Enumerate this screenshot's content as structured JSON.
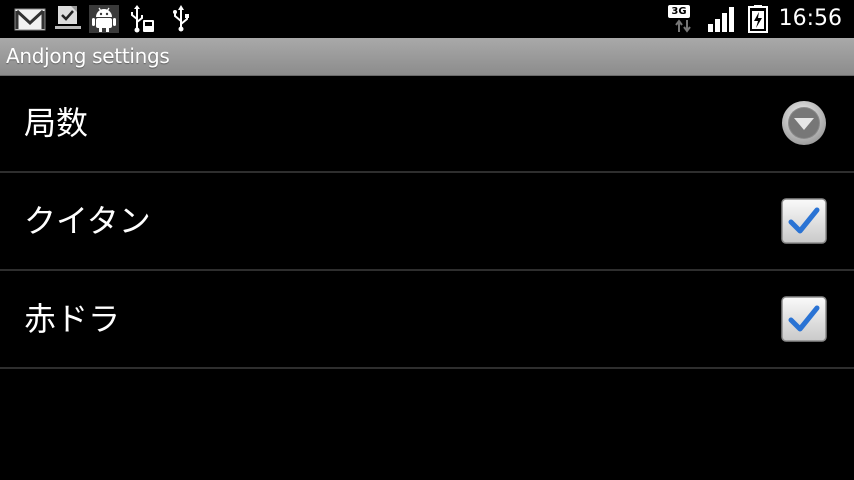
{
  "status_bar": {
    "notifications": [
      "gmail-icon",
      "download-done-icon",
      "android-debug-icon",
      "usb-storage-icon",
      "usb-icon"
    ],
    "network_type": "3G",
    "time": "16:56"
  },
  "title_bar": {
    "title": "Andjong settings"
  },
  "preferences": [
    {
      "label": "局数",
      "widget": "dropdown"
    },
    {
      "label": "クイタン",
      "widget": "checkbox",
      "checked": true
    },
    {
      "label": "赤ドラ",
      "widget": "checkbox",
      "checked": true
    }
  ],
  "colors": {
    "background": "#000000",
    "titlebar": "#9a9a9a",
    "divider": "#2e2e2e",
    "checkmark": "#2a73d4"
  }
}
